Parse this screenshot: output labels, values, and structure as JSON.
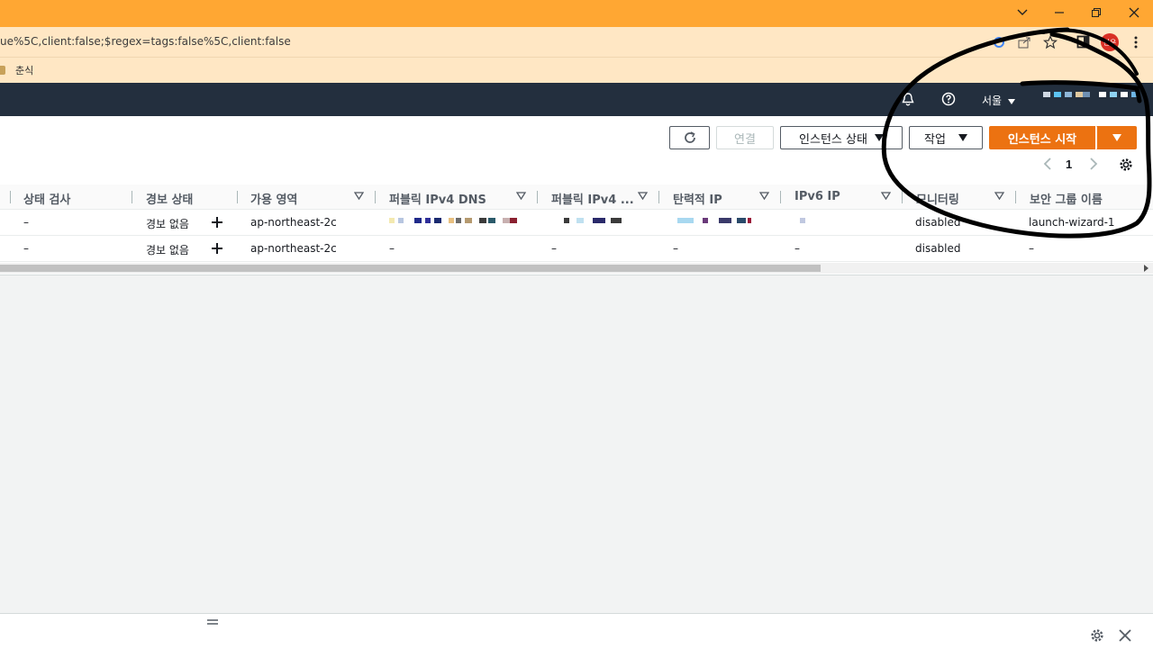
{
  "browser": {
    "url_fragment": "ue%5C,client:false;$regex=tags:false%5C,client:false",
    "bookmark_label": "춘식",
    "profile_badge": "현우",
    "accent_color": "#ffa733"
  },
  "aws_nav": {
    "region": "서울"
  },
  "toolbar": {
    "connect_label": "연결",
    "instance_state_label": "인스턴스 상태",
    "actions_label": "작업",
    "launch_label": "인스턴스 시작",
    "page_number": "1"
  },
  "table": {
    "columns": [
      {
        "label": "상태 검사"
      },
      {
        "label": "경보 상태"
      },
      {
        "label": "가용 영역"
      },
      {
        "label": "퍼블릭 IPv4 DNS"
      },
      {
        "label": "퍼블릭 IPv4 ..."
      },
      {
        "label": "탄력적 IP"
      },
      {
        "label": "IPv6 IP"
      },
      {
        "label": "모니터링"
      },
      {
        "label": "보안 그룹 이름"
      }
    ],
    "rows": [
      {
        "status_check": "–",
        "alarm_status": "경보 없음",
        "availability_zone": "ap-northeast-2c",
        "public_dns": "",
        "public_ipv4": "",
        "elastic_ip": "",
        "ipv6": "",
        "monitoring": "disabled",
        "security_group": "launch-wizard-1"
      },
      {
        "status_check": "–",
        "alarm_status": "경보 없음",
        "availability_zone": "ap-northeast-2c",
        "public_dns": "–",
        "public_ipv4": "–",
        "elastic_ip": "–",
        "ipv6": "–",
        "monitoring": "disabled",
        "security_group": "–"
      }
    ]
  },
  "colors": {
    "primary_button": "#ec7211",
    "nav_background": "#232f3e"
  }
}
